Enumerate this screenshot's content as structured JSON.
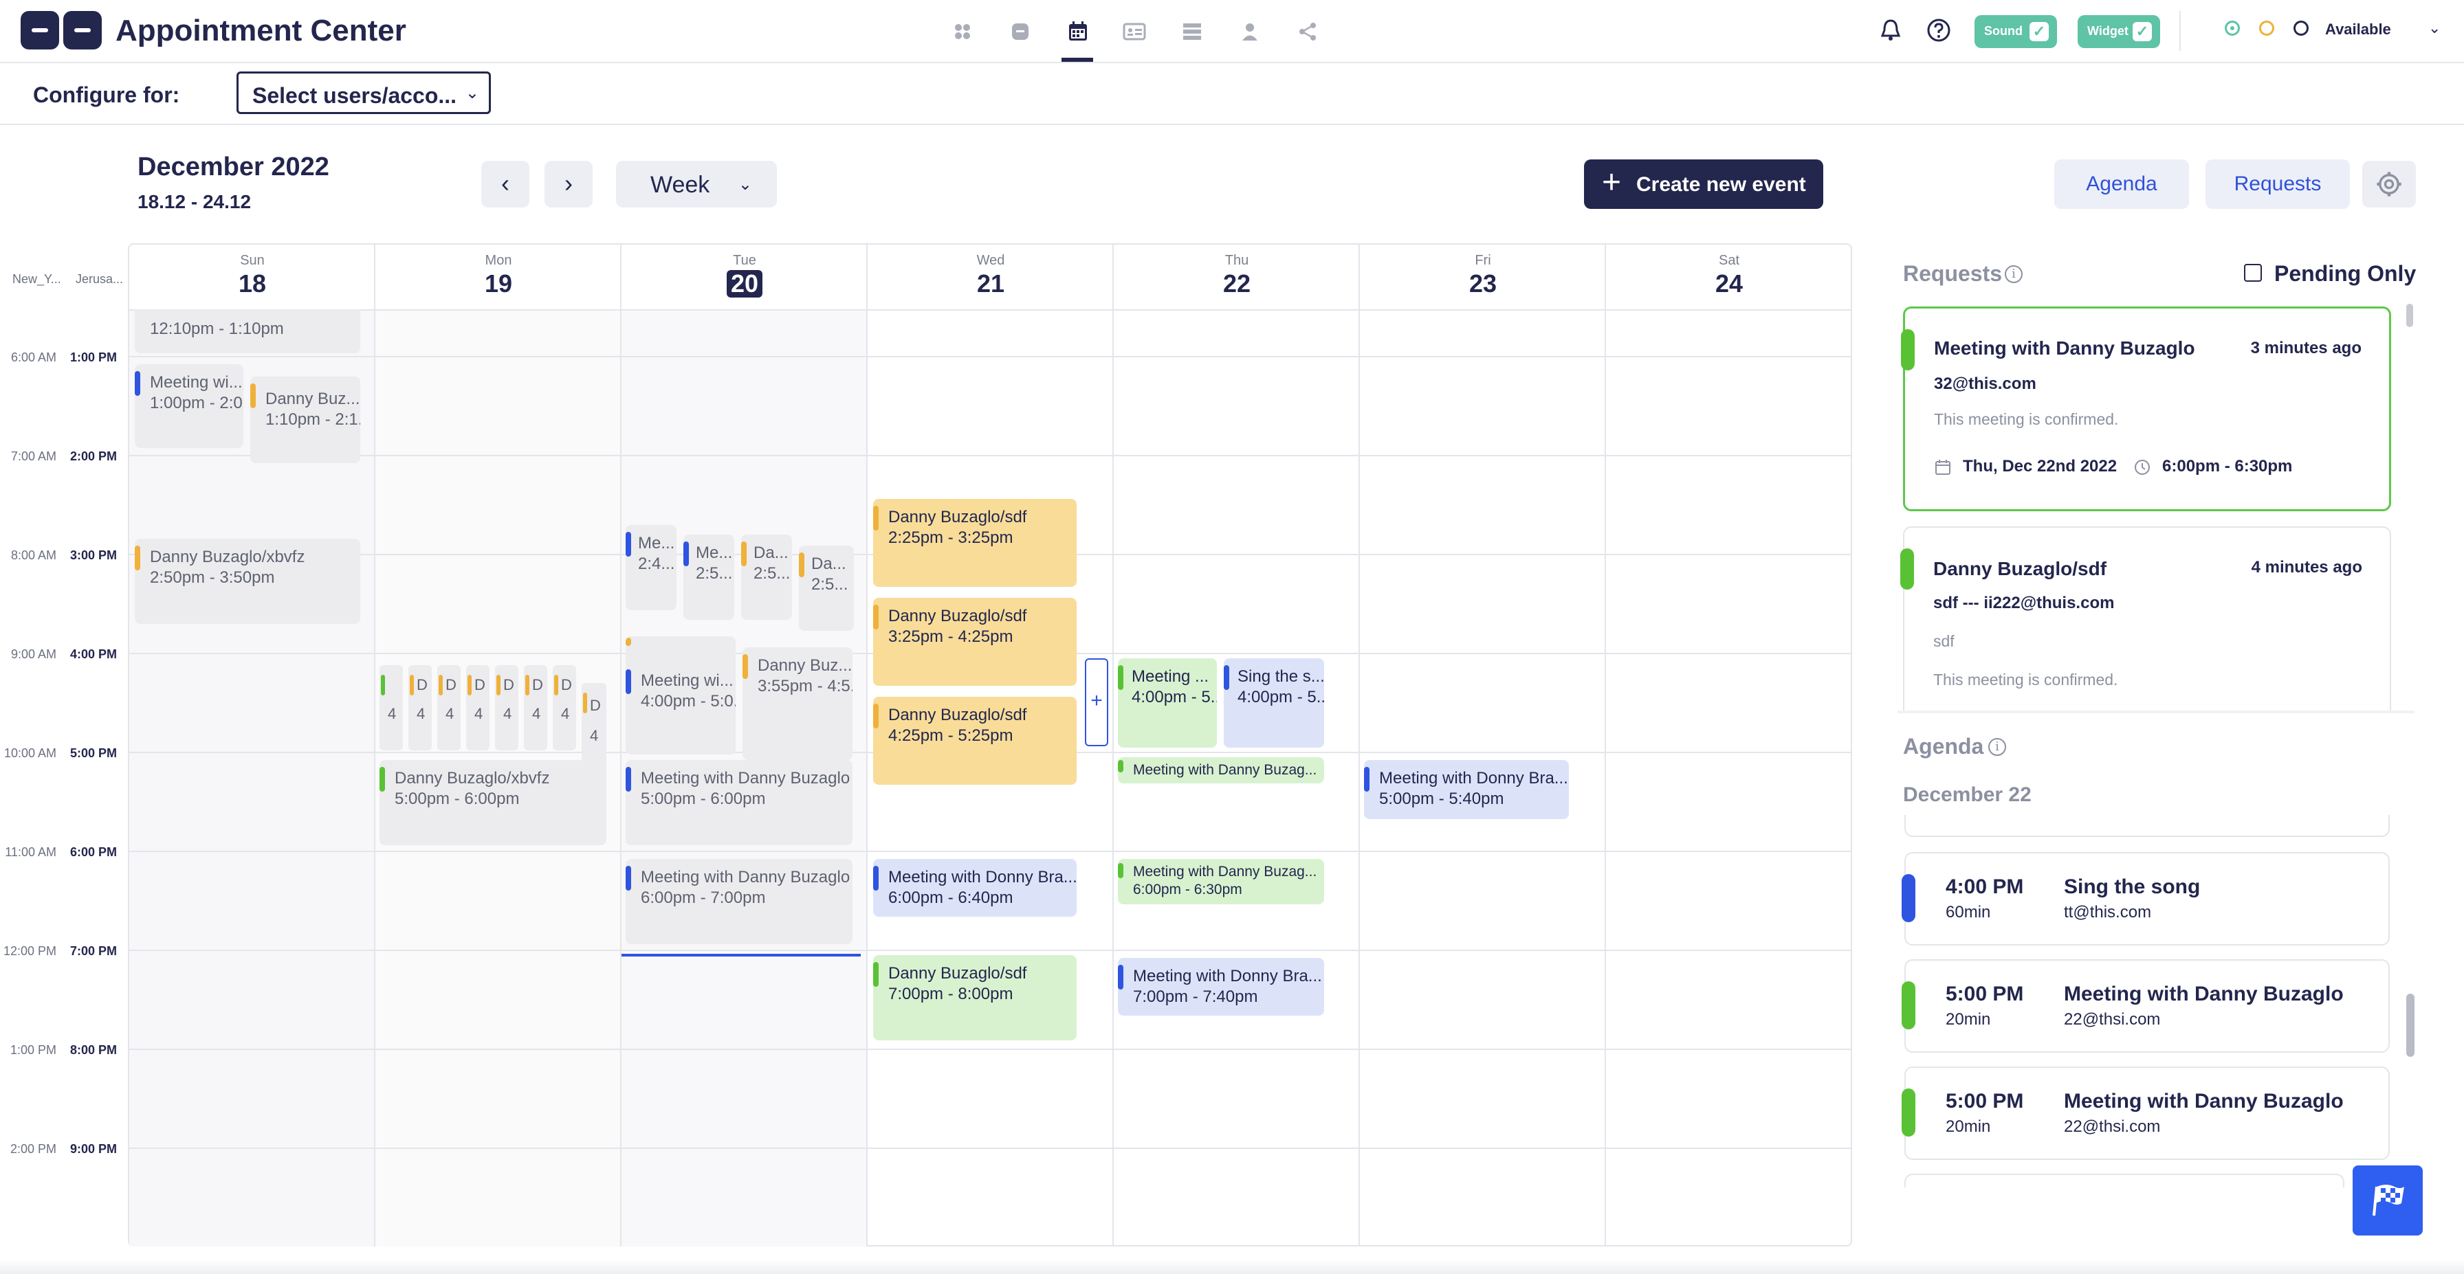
{
  "app": {
    "title": "Appointment Center"
  },
  "topbar": {
    "nav_icons": [
      "grid-icon",
      "chat-icon",
      "calendar-icon",
      "contact-card-icon",
      "list-icon",
      "user-icon",
      "share-icon"
    ],
    "sound_label": "Sound",
    "widget_label": "Widget",
    "status_label": "Available"
  },
  "configure": {
    "label": "Configure for:",
    "select_value": "Select users/acco..."
  },
  "toolbar": {
    "month": "December 2022",
    "range": "18.12 - 24.12",
    "view": "Week",
    "create_label": "Create new event",
    "agenda_label": "Agenda",
    "requests_label": "Requests"
  },
  "calendar": {
    "timezones": [
      "New_Y...",
      "Jerusa..."
    ],
    "days": [
      {
        "name": "Sun",
        "date": "18"
      },
      {
        "name": "Mon",
        "date": "19"
      },
      {
        "name": "Tue",
        "date": "20"
      },
      {
        "name": "Wed",
        "date": "21"
      },
      {
        "name": "Thu",
        "date": "22"
      },
      {
        "name": "Fri",
        "date": "23"
      },
      {
        "name": "Sat",
        "date": "24"
      }
    ],
    "hours": [
      {
        "ny": "6:00 AM",
        "jer": "1:00 PM"
      },
      {
        "ny": "7:00 AM",
        "jer": "2:00 PM"
      },
      {
        "ny": "8:00 AM",
        "jer": "3:00 PM"
      },
      {
        "ny": "9:00 AM",
        "jer": "4:00 PM"
      },
      {
        "ny": "10:00 AM",
        "jer": "5:00 PM"
      },
      {
        "ny": "11:00 AM",
        "jer": "6:00 PM"
      },
      {
        "ny": "12:00 PM",
        "jer": "7:00 PM"
      },
      {
        "ny": "1:00 PM",
        "jer": "8:00 PM"
      },
      {
        "ny": "2:00 PM",
        "jer": "9:00 PM"
      }
    ],
    "events": {
      "sun_top": {
        "time": "12:10pm - 1:10pm"
      },
      "sun_a": {
        "title": "Meeting wi...",
        "time": "1:00pm - 2:0..."
      },
      "sun_b": {
        "title": "Danny Buz...",
        "time": "1:10pm - 2:1..."
      },
      "sun_c": {
        "title": "Danny Buzaglo/xbvfz",
        "time": "2:50pm - 3:50pm"
      },
      "mon_a": {
        "title": "Danny Buzaglo/xbvfz",
        "time": "5:00pm - 6:00pm"
      },
      "tue_a": {
        "title": "Me...",
        "time": "2:4..."
      },
      "tue_b": {
        "title": "Me...",
        "time": "2:5..."
      },
      "tue_c": {
        "title": "Da...",
        "time": "2:5..."
      },
      "tue_d": {
        "title": "Da...",
        "time": "2:5..."
      },
      "tue_e": {
        "title": "Meeting wi...",
        "time": "4:00pm - 5:0..."
      },
      "tue_f": {
        "title": "Danny Buz...",
        "time": "3:55pm - 4:5..."
      },
      "tue_g": {
        "title": "Meeting with Danny Buzaglo",
        "time": "5:00pm - 6:00pm"
      },
      "tue_h": {
        "title": "Meeting with Danny Buzaglo",
        "time": "6:00pm - 7:00pm"
      },
      "wed_a": {
        "title": "Danny Buzaglo/sdf",
        "time": "2:25pm - 3:25pm"
      },
      "wed_b": {
        "title": "Danny Buzaglo/sdf",
        "time": "3:25pm - 4:25pm"
      },
      "wed_c": {
        "title": "Danny Buzaglo/sdf",
        "time": "4:25pm - 5:25pm"
      },
      "wed_d": {
        "title": "Meeting with Donny Bra...",
        "time": "6:00pm - 6:40pm"
      },
      "wed_e": {
        "title": "Danny Buzaglo/sdf",
        "time": "7:00pm - 8:00pm"
      },
      "thu_a": {
        "title": "Meeting ...",
        "time": "4:00pm - 5..."
      },
      "thu_b": {
        "title": "Sing the s...",
        "time": "4:00pm - 5..."
      },
      "thu_c": {
        "title": "Meeting with Danny Buzag..."
      },
      "thu_d": {
        "title": "Meeting with Danny Buzag...",
        "time": "6:00pm - 6:30pm"
      },
      "thu_e": {
        "title": "Meeting with Donny Bra...",
        "time": "7:00pm - 7:40pm"
      },
      "fri_a": {
        "title": "Meeting with Donny Bra...",
        "time": "5:00pm - 5:40pm"
      }
    },
    "mon_minis": [
      {
        "t": "D",
        "n": "4"
      },
      {
        "t": "D",
        "n": "4"
      },
      {
        "t": "D",
        "n": "4"
      },
      {
        "t": "D",
        "n": "4"
      },
      {
        "t": "D",
        "n": "4"
      },
      {
        "t": "D",
        "n": "4"
      },
      {
        "t": "D",
        "n": "4"
      },
      {
        "t": "D",
        "n": "4"
      }
    ]
  },
  "requests": {
    "title": "Requests",
    "pending_label": "Pending Only",
    "items": [
      {
        "name": "Meeting with Danny Buzaglo",
        "ago": "3 minutes ago",
        "email": "32@this.com",
        "status": "This meeting is confirmed.",
        "date": "Thu, Dec 22nd 2022",
        "time": "6:00pm - 6:30pm"
      },
      {
        "name": "Danny Buzaglo/sdf",
        "ago": "4 minutes ago",
        "email": "sdf --- ii222@thuis.com",
        "note": "sdf",
        "status": "This meeting is confirmed."
      }
    ]
  },
  "agenda": {
    "title": "Agenda",
    "date": "December 22",
    "items": [
      {
        "time": "4:00 PM",
        "duration": "60min",
        "title": "Sing the song",
        "email": "tt@this.com",
        "color": "#2f54e0"
      },
      {
        "time": "5:00 PM",
        "duration": "20min",
        "title": "Meeting with Danny Buzaglo",
        "email": "22@thsi.com",
        "color": "#59c234"
      },
      {
        "time": "5:00 PM",
        "duration": "20min",
        "title": "Meeting with Danny Buzaglo",
        "email": "22@thsi.com",
        "color": "#59c234"
      }
    ]
  },
  "colors": {
    "brand": "#23264d",
    "accent_blue": "#2f54e0",
    "accent_green": "#59c234",
    "accent_orange": "#efb13a"
  }
}
